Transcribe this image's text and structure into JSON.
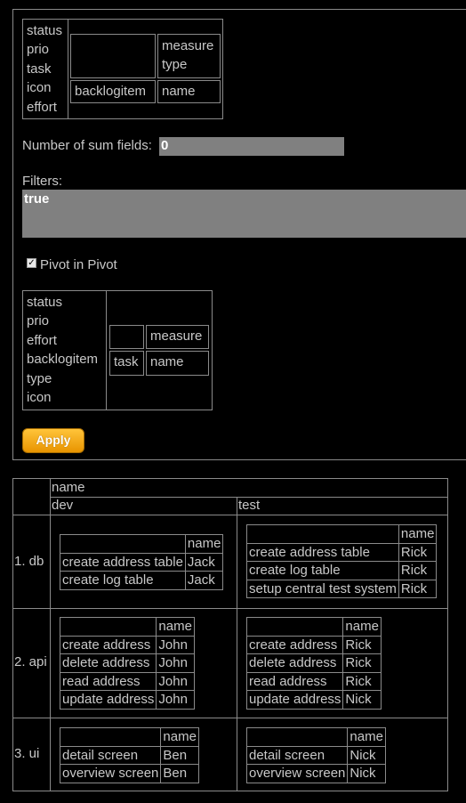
{
  "config": {
    "available_fields": [
      "status",
      "prio",
      "task",
      "icon",
      "effort"
    ],
    "top_axis": [
      "measure",
      "type"
    ],
    "left_axis": [
      "backlogitem"
    ],
    "data_field": "name",
    "sum_fields_label": "Number of sum fields:",
    "sum_fields_value": "0",
    "filters_label": "Filters:",
    "filters_value": "true",
    "pivot_in_pivot_label": "Pivot in Pivot",
    "pivot_in_pivot_checked": true,
    "inner_available_fields": [
      "status",
      "prio",
      "effort",
      "backlogitem",
      "type",
      "icon"
    ],
    "inner_top_axis": "measure",
    "inner_left_axis": "task",
    "inner_data_field": "name",
    "apply_label": "Apply"
  },
  "result": {
    "column_field": "name",
    "columns": [
      "dev",
      "test"
    ],
    "rows": [
      {
        "label": "1. db",
        "dev": {
          "header": "name",
          "items": [
            [
              "create address table",
              "Jack"
            ],
            [
              "create log table",
              "Jack"
            ]
          ]
        },
        "test": {
          "header": "name",
          "items": [
            [
              "create address table",
              "Rick"
            ],
            [
              "create log table",
              "Rick"
            ],
            [
              "setup central test system",
              "Rick"
            ]
          ]
        }
      },
      {
        "label": "2. api",
        "dev": {
          "header": "name",
          "items": [
            [
              "create address",
              "John"
            ],
            [
              "delete address",
              "John"
            ],
            [
              "read address",
              "John"
            ],
            [
              "update address",
              "John"
            ]
          ]
        },
        "test": {
          "header": "name",
          "items": [
            [
              "create address",
              "Rick"
            ],
            [
              "delete address",
              "Rick"
            ],
            [
              "read address",
              "Rick"
            ],
            [
              "update address",
              "Nick"
            ]
          ]
        }
      },
      {
        "label": "3. ui",
        "dev": {
          "header": "name",
          "items": [
            [
              "detail screen",
              "Ben"
            ],
            [
              "overview screen",
              "Ben"
            ]
          ]
        },
        "test": {
          "header": "name",
          "items": [
            [
              "detail screen",
              "Nick"
            ],
            [
              "overview screen",
              "Nick"
            ]
          ]
        }
      }
    ]
  }
}
